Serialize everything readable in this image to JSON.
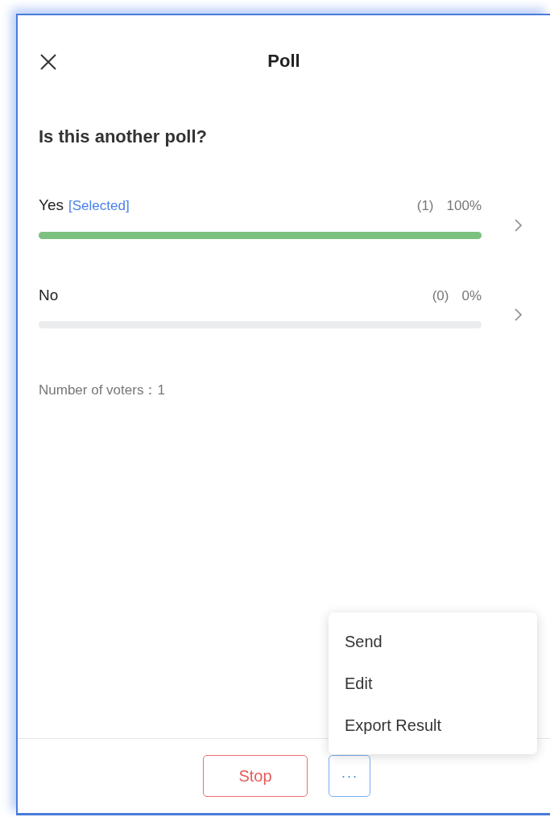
{
  "header": {
    "title": "Poll"
  },
  "question": "Is this another poll?",
  "selected_tag": "[Selected]",
  "options": [
    {
      "label": "Yes",
      "selected": true,
      "count": "(1)",
      "percent": "100%",
      "level": 1
    },
    {
      "label": "No",
      "selected": false,
      "count": "(0)",
      "percent": "0%",
      "level": 0
    }
  ],
  "voters": "Number of voters：1",
  "footer": {
    "stop": "Stop",
    "more": "···"
  },
  "menu": [
    "Send",
    "Edit",
    "Export Result"
  ]
}
